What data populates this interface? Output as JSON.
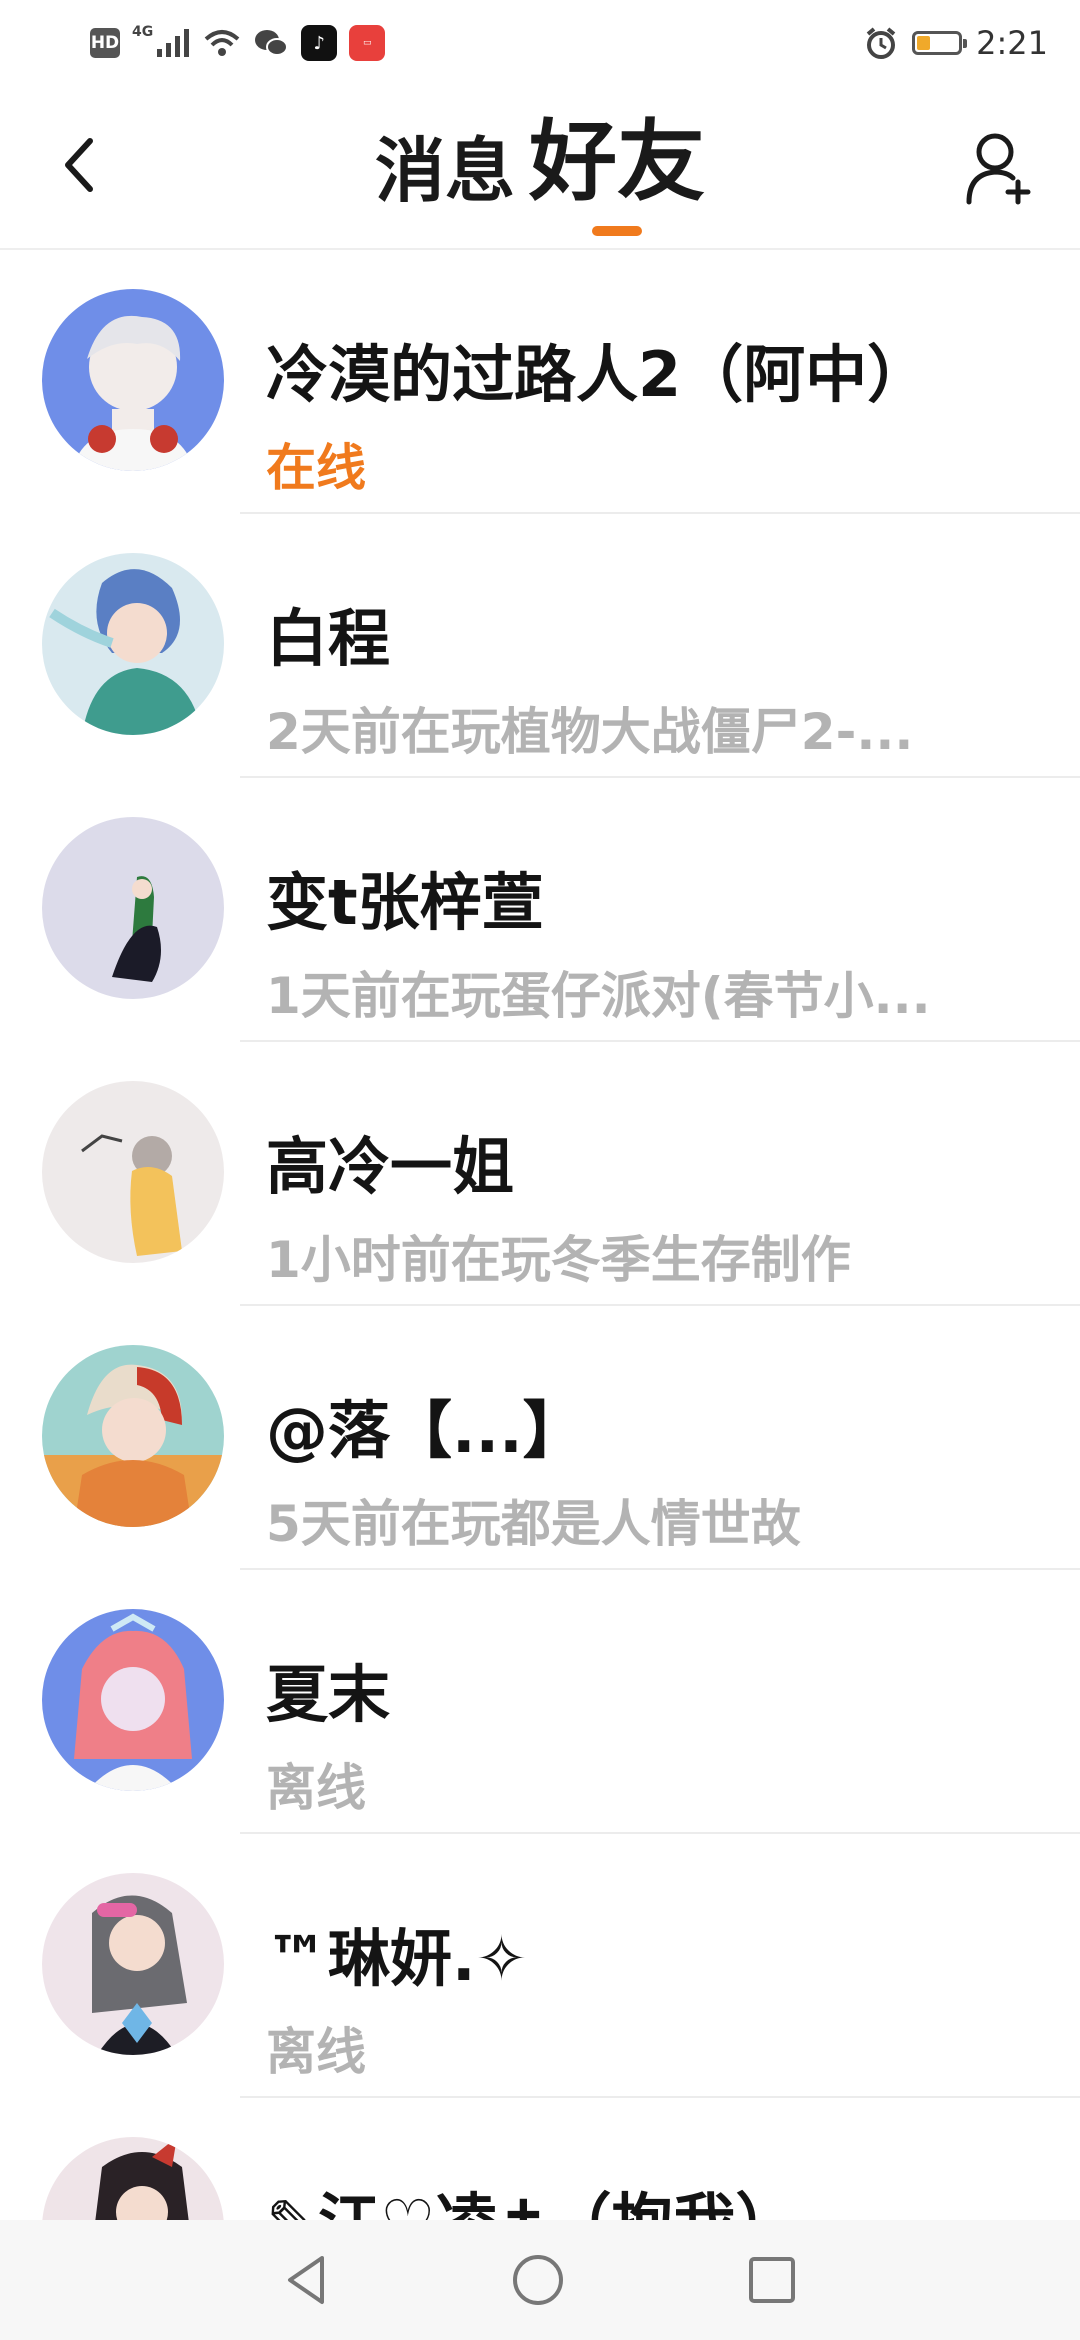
{
  "status_bar": {
    "hd_label": "HD",
    "network_label": "4G",
    "time": "2:21",
    "battery_level": 0.3
  },
  "header": {
    "tab_messages": "消息",
    "tab_friends": "好友",
    "active_tab": "好友",
    "accent_color": "#f07a1d"
  },
  "friends": [
    {
      "name": "冷漠的过路人2（阿中）",
      "status": "在线"
    },
    {
      "name": "白程",
      "status": "2天前在玩植物大战僵尸2-..."
    },
    {
      "name": "变t张梓萱",
      "status": "1天前在玩蛋仔派对(春节小..."
    },
    {
      "name": "高冷一姐",
      "status": "1小时前在玩冬季生存制作"
    },
    {
      "name": "@落【...】",
      "status": "5天前在玩都是人情世故"
    },
    {
      "name": "夏末",
      "status": "离线"
    },
    {
      "name": "™琳妍.✧",
      "status": "离线"
    },
    {
      "name": "✎江♡凌✝（抱我）",
      "status": ""
    }
  ],
  "icons": {
    "back": "chevron-left-icon",
    "add_friend": "add-user-icon",
    "nav_back": "triangle-back-icon",
    "nav_home": "circle-home-icon",
    "nav_recent": "square-recents-icon"
  }
}
